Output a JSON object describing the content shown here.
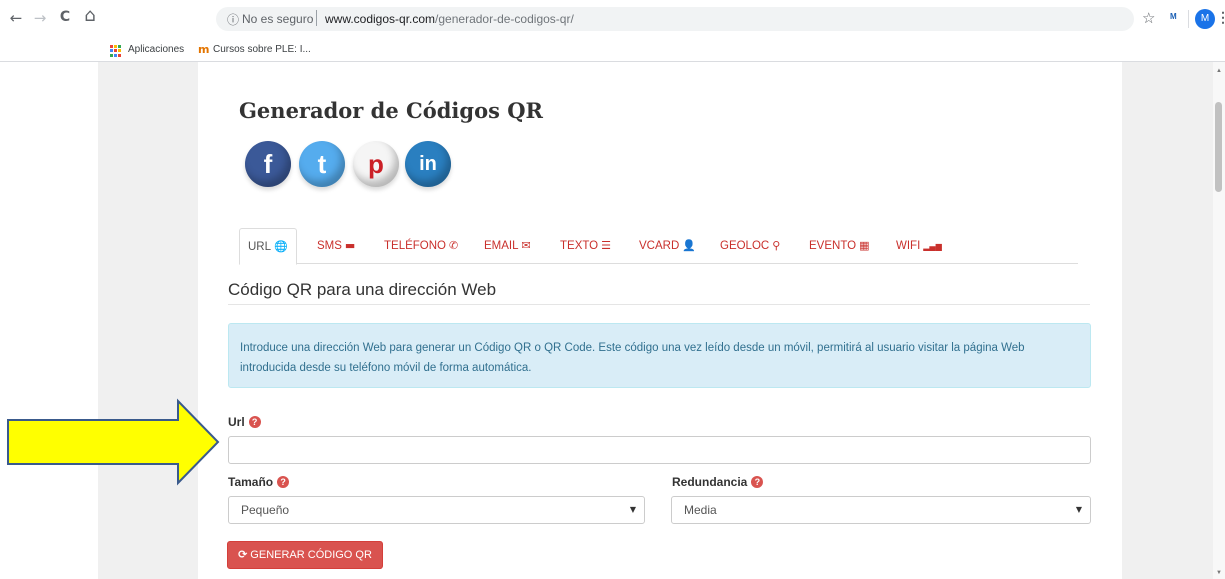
{
  "browser": {
    "back_icon": "←",
    "forward_icon": "→",
    "reload_icon": "C",
    "home_icon": "⌂",
    "info_icon": "ⓘ",
    "security_text": "No es seguro",
    "url_host": "www.codigos-qr.com",
    "url_path": "/generador-de-codigos-qr/",
    "star_icon": "☆",
    "extension_text": "M",
    "avatar_letter": "M",
    "menu_icon": "⋮",
    "bookmarks": [
      {
        "label": "Aplicaciones"
      },
      {
        "label": "Cursos sobre PLE: I..."
      }
    ]
  },
  "page": {
    "title": "Generador de Códigos QR",
    "social": [
      {
        "name": "facebook",
        "glyph": "f",
        "color": "#3b5998"
      },
      {
        "name": "twitter",
        "glyph": "t",
        "color": "#55acee"
      },
      {
        "name": "pinterest",
        "glyph": "p",
        "color": "#cb2027"
      },
      {
        "name": "linkedin",
        "glyph": "in",
        "color": "#2a7fc0"
      }
    ],
    "tabs": [
      {
        "label": "URL",
        "icon": "🌐"
      },
      {
        "label": "SMS",
        "icon": "▬"
      },
      {
        "label": "TELÉFONO",
        "icon": "✆"
      },
      {
        "label": "EMAIL",
        "icon": "✉"
      },
      {
        "label": "TEXTO",
        "icon": "☰"
      },
      {
        "label": "VCARD",
        "icon": "👤"
      },
      {
        "label": "GEOLOC",
        "icon": "⚲"
      },
      {
        "label": "EVENTO",
        "icon": "▦"
      },
      {
        "label": "WIFI",
        "icon": "▂▄▆"
      }
    ],
    "section_title": "Código QR para una dirección Web",
    "alert_text": "Introduce una dirección Web para generar un Código QR o QR Code. Este código una vez leído desde un móvil, permitirá al usuario visitar la página Web introducida desde su teléfono móvil de forma automática.",
    "url_label": "Url",
    "url_value": "",
    "help_icon": "?",
    "size_label": "Tamaño",
    "size_value": "Pequeño",
    "redundancy_label": "Redundancia",
    "redundancy_value": "Media",
    "caret_icon": "▼",
    "generate_label": "GENERAR CÓDIGO QR",
    "generate_icon": "⟳"
  },
  "colors": {
    "accent_red": "#d9534f",
    "alert_bg": "#d9edf7",
    "arrow_fill": "#ffff00",
    "arrow_stroke": "#3a5a8c"
  }
}
